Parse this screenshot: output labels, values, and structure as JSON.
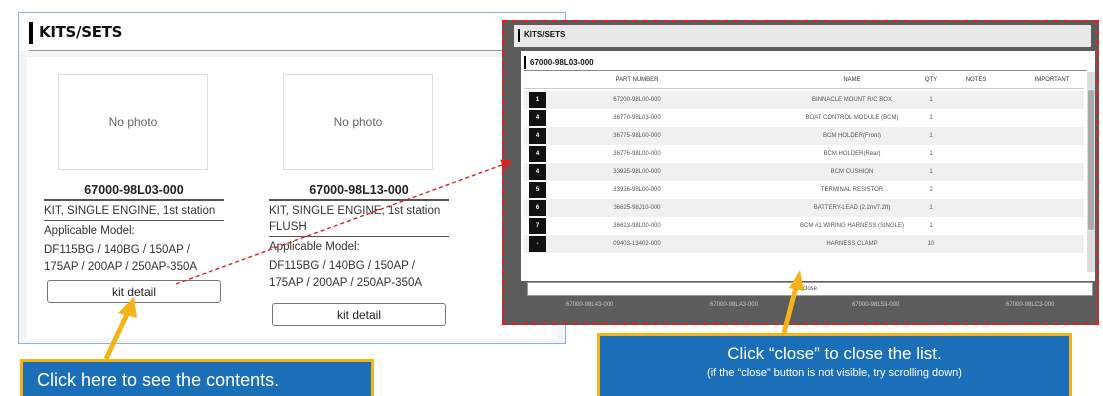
{
  "panel": {
    "title": "KITS/SETS",
    "kits": [
      {
        "photo": "No photo",
        "part_number": "67000-98L03-000",
        "description": "KIT, SINGLE ENGINE, 1st station",
        "applicable_label": "Applicable Model:",
        "models": "DF115BG / 140BG / 150AP / 175AP / 200AP / 250AP-350A",
        "button": "kit detail"
      },
      {
        "photo": "No photo",
        "part_number": "67000-98L13-000",
        "description": "KIT, SINGLE ENGINE, 1st station FLUSH",
        "applicable_label": "Applicable Model:",
        "models": "DF115BG / 140BG / 150AP / 175AP / 200AP / 250AP-350A",
        "button": "kit detail"
      }
    ]
  },
  "modal": {
    "header_title": "KITS/SETS",
    "kit_title": "67000-98L03-000",
    "columns": [
      "PART NUMBER",
      "NAME",
      "QTY",
      "NOTES",
      "IMPORTANT"
    ],
    "rows": [
      {
        "idx": "1",
        "part": "67200-98L00-000",
        "name": "BINNACLE MOUNT R/C BOX",
        "qty": "1"
      },
      {
        "idx": "4",
        "part": "36770-98L03-000",
        "name": "BOAT CONTROL MODULE (BCM)",
        "qty": "1"
      },
      {
        "idx": "4",
        "part": "36775-98L00-000",
        "name": "BCM HOLDER(Front)",
        "qty": "1"
      },
      {
        "idx": "4",
        "part": "36776-98L00-000",
        "name": "BCM HOLDER(Rear)",
        "qty": "1"
      },
      {
        "idx": "4",
        "part": "33925-98L00-000",
        "name": "BCM CUSHION",
        "qty": "1"
      },
      {
        "idx": "5",
        "part": "33926-98L00-000",
        "name": "TERMINAL RESISTOR",
        "qty": "2"
      },
      {
        "idx": "6",
        "part": "36625-98J10-000",
        "name": "BATTERY-LEAD (2.2m/7.2ft)",
        "qty": "1"
      },
      {
        "idx": "7",
        "part": "36623-98L00-000",
        "name": "BCM #1 WIRING HARNESS (SINGLE)",
        "qty": "1"
      },
      {
        "idx": "-",
        "part": "09403-13402-000",
        "name": "HARNESS CLAMP",
        "qty": "10"
      }
    ],
    "close_label": "close",
    "bottom_parts": [
      "67000-98L43-000",
      "67000-98LA3-000",
      "67000-98L53-000",
      "67000-98LC3-000"
    ]
  },
  "callouts": {
    "left": "Click here to see the contents.",
    "right_line1": "Click “close” to close the list.",
    "right_line2": "(if the “close” button is not visible, try scrolling down)"
  },
  "colors": {
    "callout_bg": "#1b6fb8",
    "callout_border": "#f3b319",
    "dashed_border": "#e02020",
    "arrow": "#f3b319"
  }
}
